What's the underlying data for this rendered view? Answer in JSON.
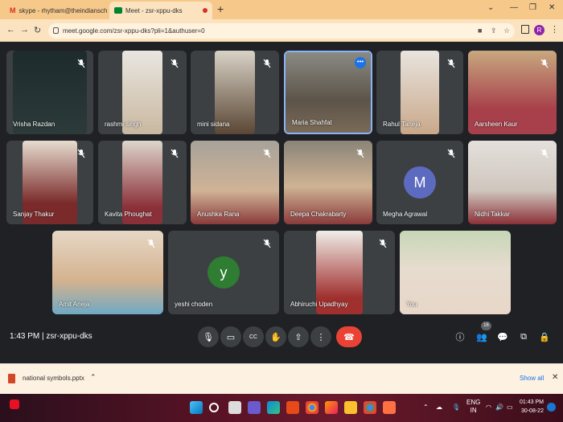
{
  "browser": {
    "tabs": [
      {
        "title": "skype - rhytham@theindiansch"
      },
      {
        "title": "Meet - zsr-xppu-dks"
      }
    ],
    "url": "meet.google.com/zsr-xppu-dks?pli=1&authuser=0",
    "profile_initial": "R"
  },
  "participants": [
    {
      "name": "Vrisha Razdan",
      "muted": true
    },
    {
      "name": "rashmi singh",
      "muted": true
    },
    {
      "name": "mini sidana",
      "muted": true
    },
    {
      "name": "Maria Shahfat",
      "muted": false,
      "presenting": true
    },
    {
      "name": "Rahul Taneja",
      "muted": true
    },
    {
      "name": "Aarsheen Kaur",
      "muted": true
    },
    {
      "name": "Sanjay Thakur",
      "muted": true
    },
    {
      "name": "Kavita Phoughat",
      "muted": true
    },
    {
      "name": "Anushka Rana",
      "muted": true
    },
    {
      "name": "Deepa Chakrabarty",
      "muted": true
    },
    {
      "name": "Megha Agrawal",
      "muted": true,
      "avatar_letter": "M",
      "avatar_color": "#5c6bc0"
    },
    {
      "name": "Nidhi Takkar",
      "muted": true
    },
    {
      "name": "Amit Aneja",
      "muted": true
    },
    {
      "name": "yeshi choden",
      "muted": true,
      "avatar_letter": "y",
      "avatar_color": "#2e7d32"
    },
    {
      "name": "Abhiruchi Upadhyay",
      "muted": true
    },
    {
      "name": "You",
      "muted": false
    }
  ],
  "meeting": {
    "time": "1:43 PM",
    "code": "zsr-xppu-dks",
    "participant_count": "16"
  },
  "download": {
    "filename": "national symbols.pptx",
    "show_all": "Show all"
  },
  "taskbar": {
    "lang_top": "ENG",
    "lang_bottom": "IN",
    "clock_time": "01:43 PM",
    "clock_date": "30-08-22"
  }
}
